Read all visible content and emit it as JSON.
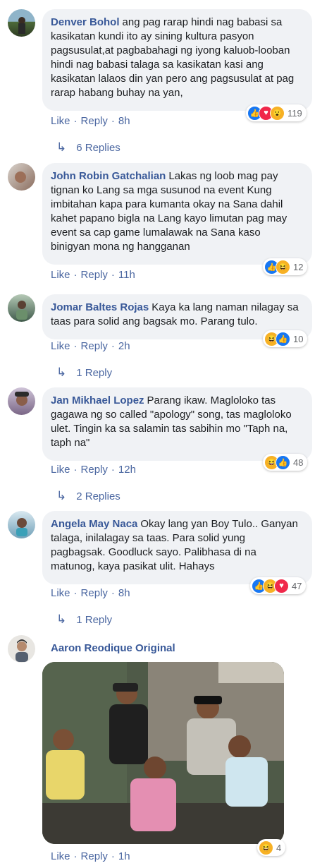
{
  "comments": [
    {
      "name": "Denver Bohol",
      "text": "ang pag rarap hindi nag babasi sa kasikatan kundi ito ay sining kultura pasyon pagsusulat,at pagbabahagi ng iyong kaluob-looban hindi nag babasi talaga sa kasikatan kasi ang kasikatan lalaos din yan pero ang pagsusulat at pag rarap habang buhay na yan,",
      "reaction_count": "119",
      "like": "Like",
      "reply": "Reply",
      "time": "8h",
      "replies": "6 Replies"
    },
    {
      "name": "John Robin Gatchalian",
      "text": "Lakas ng loob mag pay tignan ko Lang sa mga susunod na event Kung imbitahan kapa para kumanta okay na Sana dahil kahet papano bigla na Lang kayo limutan pag may event sa cap game lumalawak na Sana kaso binigyan mona ng hangganan",
      "reaction_count": "12",
      "like": "Like",
      "reply": "Reply",
      "time": "11h"
    },
    {
      "name": "Jomar Baltes Rojas",
      "text": "Kaya ka lang naman nilagay sa taas para solid ang bagsak mo. Parang tulo.",
      "reaction_count": "10",
      "like": "Like",
      "reply": "Reply",
      "time": "2h",
      "replies": "1 Reply"
    },
    {
      "name": "Jan Mikhael Lopez",
      "text": "Parang ikaw. Magloloko tas gagawa ng so called \"apology\" song, tas magloloko ulet. Tingin ka sa salamin tas sabihin mo \"Taph na, taph na\"",
      "reaction_count": "48",
      "like": "Like",
      "reply": "Reply",
      "time": "12h",
      "replies": "2 Replies"
    },
    {
      "name": "Angela May Naca",
      "text": "Okay lang yan Boy Tulo.. Ganyan talaga, inilalagay sa taas. Para solid yung pagbagsak. Goodluck sayo. Palibhasa di na matunog, kaya pasikat ulit. Hahays",
      "reaction_count": "47",
      "like": "Like",
      "reply": "Reply",
      "time": "8h",
      "replies": "1 Reply"
    },
    {
      "name": "Aaron Reodique Original",
      "reaction_count": "4",
      "like": "Like",
      "reply": "Reply",
      "time": "1h"
    }
  ],
  "colors": {
    "link": "#385898",
    "bubble": "#f0f2f5",
    "like": "#1877f2",
    "love": "#f0284a",
    "haha": "#f7b125"
  },
  "icons": [
    "like-icon",
    "love-icon",
    "haha-icon",
    "wow-icon",
    "reply-arrow-icon"
  ]
}
